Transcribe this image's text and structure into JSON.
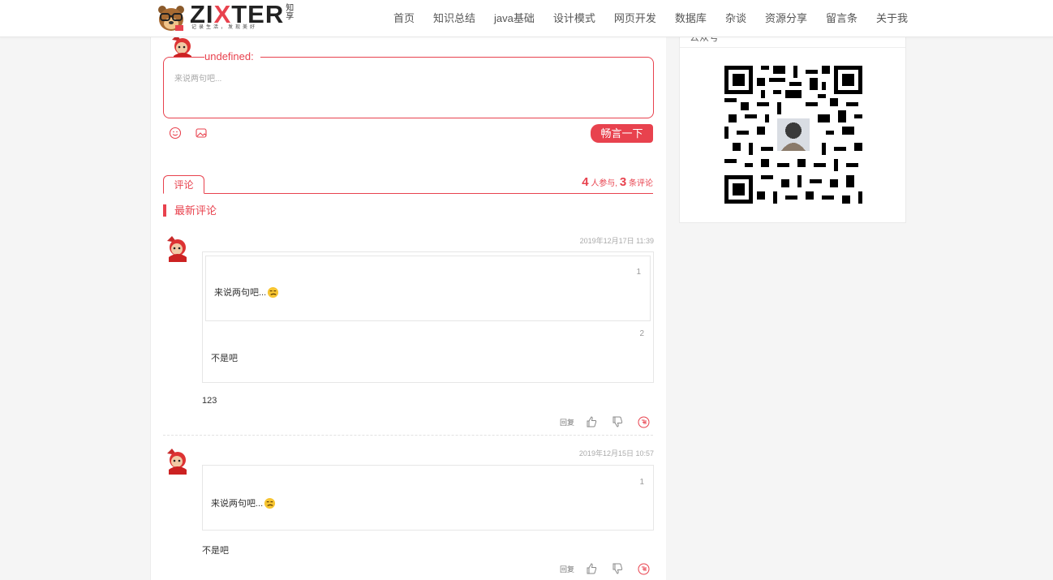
{
  "header": {
    "logo_text_prefix": "ZI",
    "logo_text_x": "X",
    "logo_text_suffix": "TER",
    "logo_side": "知享",
    "logo_sub": "记录生活，发现美好",
    "nav": [
      "首页",
      "知识总结",
      "java基础",
      "设计模式",
      "网页开发",
      "数据库",
      "杂谈",
      "资源分享",
      "留言条",
      "关于我"
    ]
  },
  "sidebar": {
    "title": "公众号",
    "qr_icon": "qr-code-icon"
  },
  "editor": {
    "username": "undefined:",
    "placeholder": "来说两句吧...",
    "submit_label": "畅言一下",
    "tools": [
      "smile-icon",
      "image-icon"
    ]
  },
  "comments_header": {
    "tab_label": "评论",
    "participants": "4",
    "participants_label": "人参与,",
    "comment_count": "3",
    "comment_count_label": "条评论",
    "latest_label": "最新评论"
  },
  "comments": [
    {
      "time": "2019年12月17日 11:39",
      "quote_nested_floor": "1",
      "quote_nested_text": "来说两句吧...",
      "quote_floor": "2",
      "quote_text": "不是吧",
      "text": "123",
      "reply_label": "回复"
    },
    {
      "time": "2019年12月15日 10:57",
      "quote_floor": "1",
      "quote_text": "来说两句吧...",
      "text": "不是吧",
      "reply_label": "回复"
    }
  ],
  "colors": {
    "accent": "#e8424e",
    "background": "#f5f5f5"
  }
}
